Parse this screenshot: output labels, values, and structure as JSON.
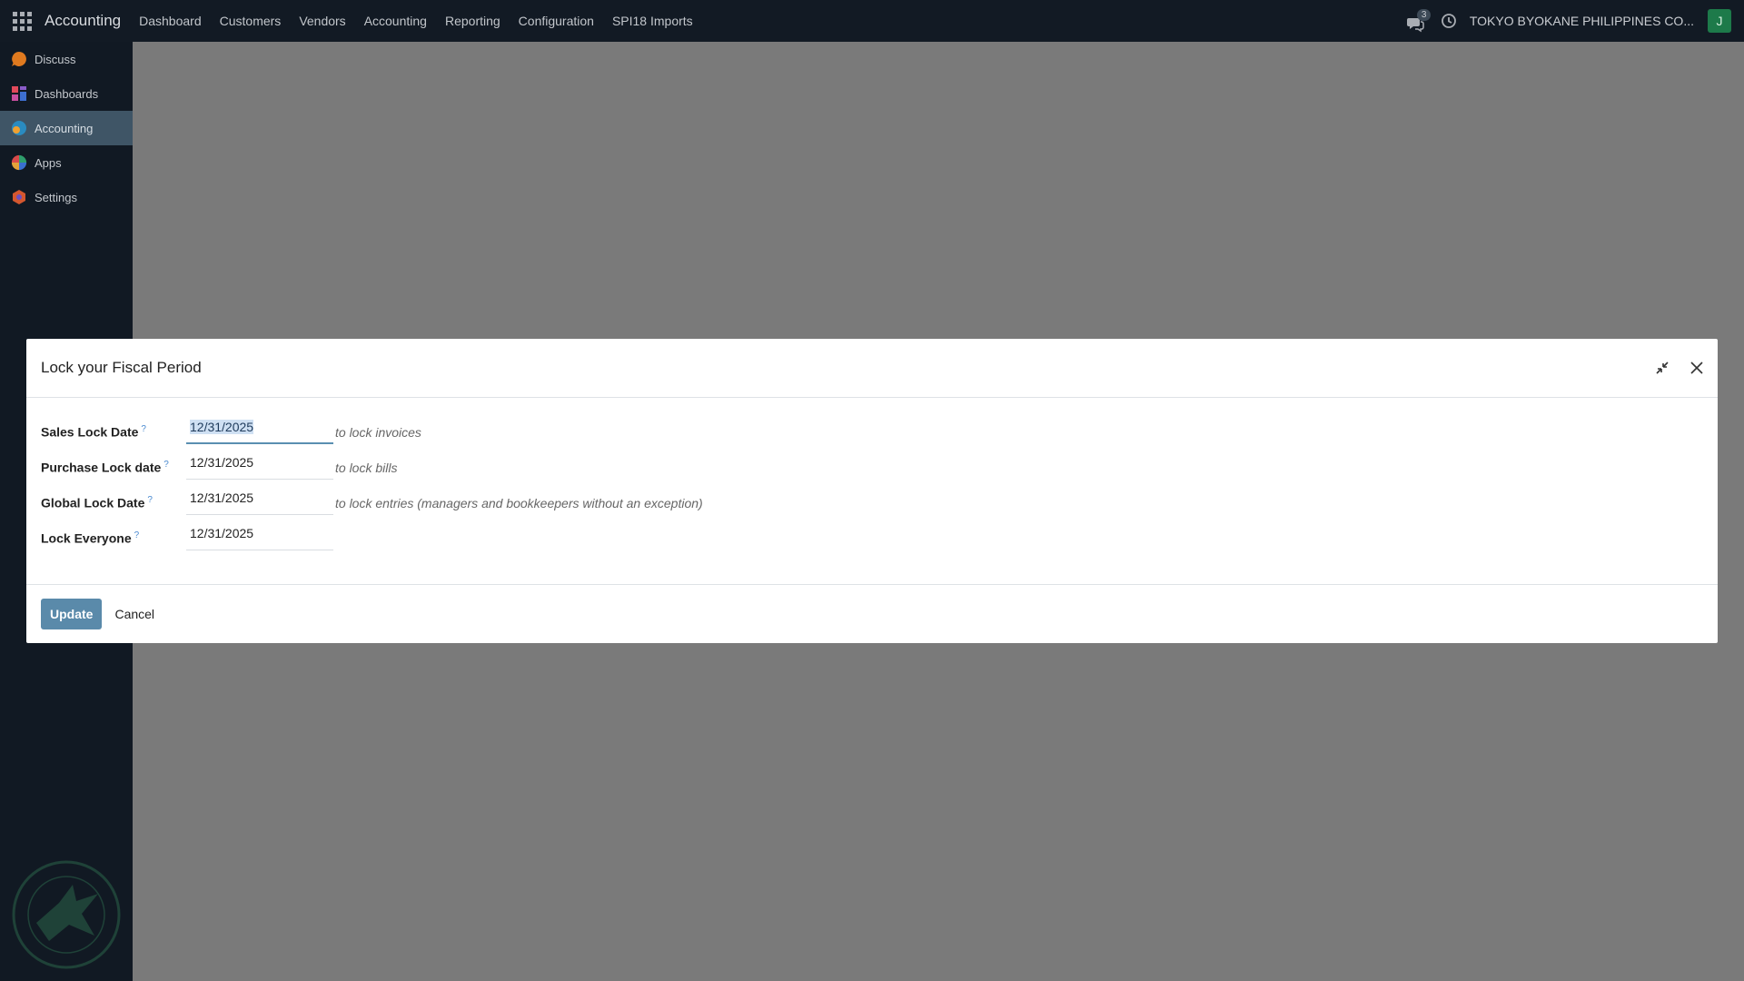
{
  "topbar": {
    "brand": "Accounting",
    "nav": [
      "Dashboard",
      "Customers",
      "Vendors",
      "Accounting",
      "Reporting",
      "Configuration",
      "SPI18 Imports"
    ],
    "chat_count": "3",
    "company": "TOKYO BYOKANE PHILIPPINES CO...",
    "avatar_letter": "J"
  },
  "sidebar": {
    "items": [
      {
        "label": "Discuss",
        "icon": "discuss-icon"
      },
      {
        "label": "Dashboards",
        "icon": "dashboards-icon"
      },
      {
        "label": "Accounting",
        "icon": "accounting-icon"
      },
      {
        "label": "Apps",
        "icon": "apps-icon"
      },
      {
        "label": "Settings",
        "icon": "settings-icon"
      }
    ],
    "active_index": 2
  },
  "modal": {
    "title": "Lock your Fiscal Period",
    "rows": [
      {
        "label": "Sales Lock Date",
        "value": "12/31/2025",
        "hint": "to lock invoices",
        "focused": true
      },
      {
        "label": "Purchase Lock date",
        "value": "12/31/2025",
        "hint": "to lock bills"
      },
      {
        "label": "Global Lock Date",
        "value": "12/31/2025",
        "hint": "to lock entries (managers and bookkeepers without an exception)"
      },
      {
        "label": "Lock Everyone",
        "value": "12/31/2025",
        "hint": ""
      }
    ],
    "tooltip_marker": "?",
    "update_label": "Update",
    "cancel_label": "Cancel"
  },
  "colors": {
    "topbar": "#121a24",
    "sidebar_active": "#3f5566",
    "primary": "#5a8aaa",
    "overlay": "#7a7a7a"
  }
}
